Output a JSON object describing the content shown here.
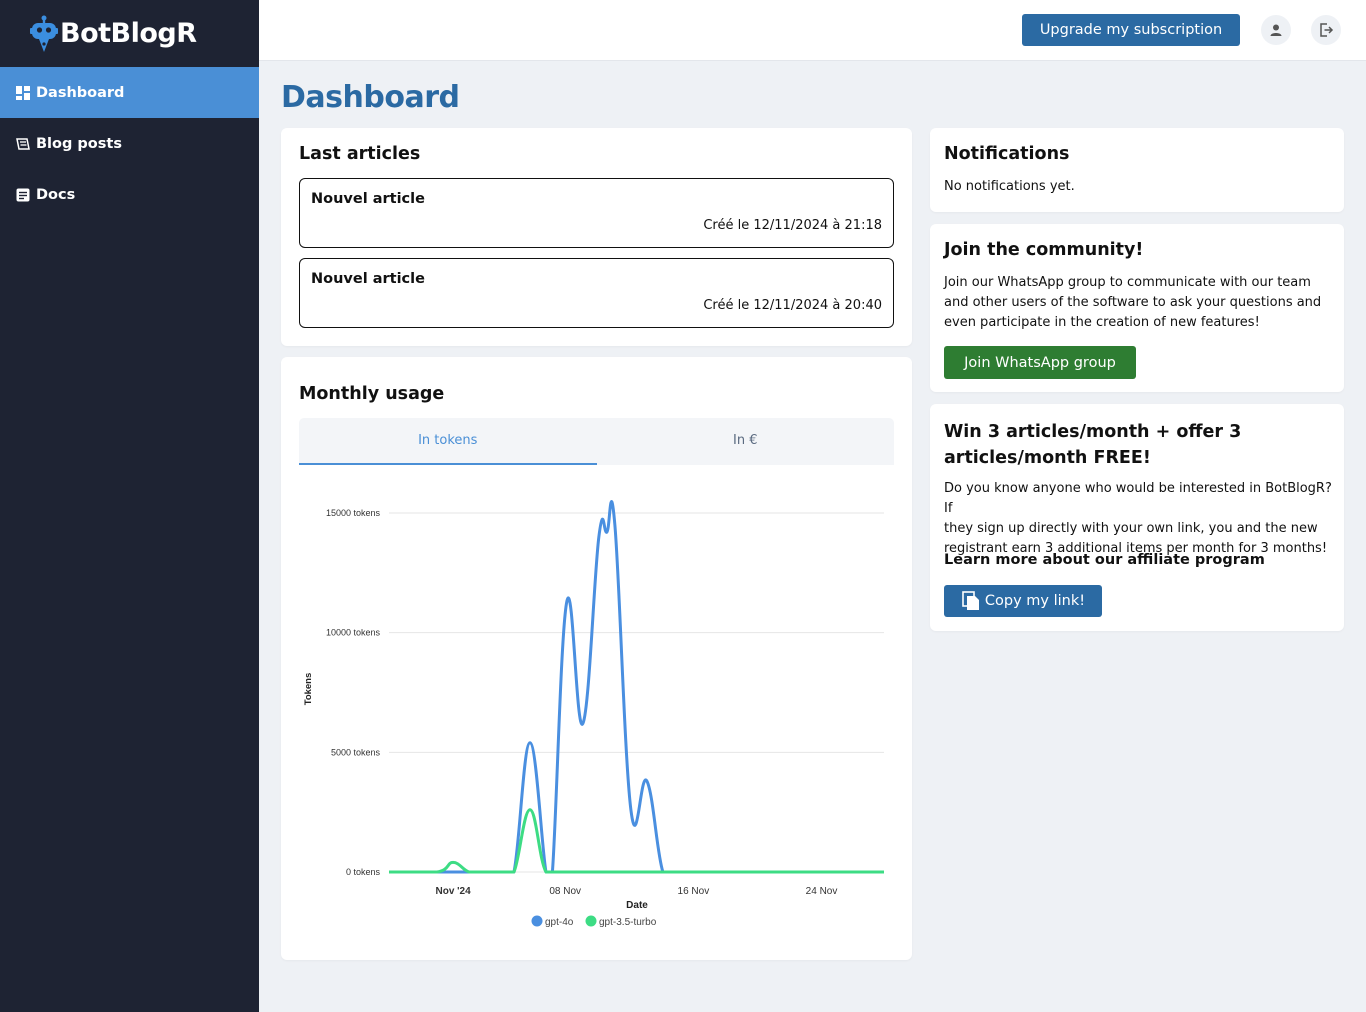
{
  "app": {
    "name": "BotBlogR"
  },
  "sidebar": {
    "items": [
      {
        "label": "Dashboard",
        "icon": "dashboard-icon",
        "active": true
      },
      {
        "label": "Blog posts",
        "icon": "blog-posts-icon",
        "active": false
      },
      {
        "label": "Docs",
        "icon": "docs-icon",
        "active": false
      }
    ]
  },
  "topbar": {
    "upgrade_label": "Upgrade my subscription",
    "account_icon": "user-icon",
    "logout_icon": "logout-icon"
  },
  "page": {
    "title": "Dashboard"
  },
  "last_articles": {
    "title": "Last articles",
    "items": [
      {
        "title": "Nouvel article",
        "date": "Créé le 12/11/2024 à 21:18"
      },
      {
        "title": "Nouvel article",
        "date": "Créé le 12/11/2024 à 20:40"
      }
    ]
  },
  "monthly_usage": {
    "title": "Monthly usage",
    "tabs": [
      {
        "label": "In tokens",
        "active": true
      },
      {
        "label": "In €",
        "active": false
      }
    ]
  },
  "chart_data": {
    "type": "line",
    "xlabel": "Date",
    "ylabel": "Tokens",
    "ylim": [
      0,
      15000
    ],
    "y_ticks": [
      {
        "value": 0,
        "label": "0 tokens"
      },
      {
        "value": 5000,
        "label": "5000 tokens"
      },
      {
        "value": 10000,
        "label": "10000 tokens"
      },
      {
        "value": 15000,
        "label": "15000 tokens"
      }
    ],
    "x_ticks": [
      {
        "day": 1,
        "label": "Nov '24",
        "bold": true
      },
      {
        "day": 8,
        "label": "08 Nov",
        "bold": false
      },
      {
        "day": 16,
        "label": "16 Nov",
        "bold": false
      },
      {
        "day": 24,
        "label": "24 Nov",
        "bold": false
      }
    ],
    "xlim": [
      -3,
      27.9
    ],
    "grid": true,
    "legend_position": "bottom",
    "series": [
      {
        "name": "gpt-4o",
        "color": "#4a8fe0",
        "points": [
          [
            -3,
            0
          ],
          [
            0,
            0
          ],
          [
            1,
            0
          ],
          [
            2,
            0
          ],
          [
            3,
            0
          ],
          [
            4,
            0
          ],
          [
            4.8,
            0
          ],
          [
            5.8,
            5400
          ],
          [
            6.8,
            0
          ],
          [
            7.2,
            0
          ],
          [
            8.1,
            11300
          ],
          [
            9.1,
            6200
          ],
          [
            10.1,
            14000
          ],
          [
            10.6,
            14200
          ],
          [
            11.1,
            14500
          ],
          [
            12.1,
            2600
          ],
          [
            13.1,
            3800
          ],
          [
            14.1,
            0
          ],
          [
            15,
            0
          ],
          [
            16,
            0
          ],
          [
            18,
            0
          ],
          [
            20,
            0
          ],
          [
            22,
            0
          ],
          [
            24,
            0
          ],
          [
            26,
            0
          ],
          [
            27.9,
            0
          ]
        ]
      },
      {
        "name": "gpt-3.5-turbo",
        "color": "#3ddc84",
        "points": [
          [
            -3,
            0
          ],
          [
            0,
            0
          ],
          [
            1,
            400
          ],
          [
            2,
            0
          ],
          [
            3,
            0
          ],
          [
            4,
            0
          ],
          [
            4.8,
            0
          ],
          [
            5.8,
            2600
          ],
          [
            6.8,
            0
          ],
          [
            8,
            0
          ],
          [
            10,
            0
          ],
          [
            12,
            0
          ],
          [
            14,
            0
          ],
          [
            16,
            0
          ],
          [
            18,
            0
          ],
          [
            20,
            0
          ],
          [
            22,
            0
          ],
          [
            24,
            0
          ],
          [
            26,
            0
          ],
          [
            27.9,
            0
          ]
        ]
      }
    ]
  },
  "notifications": {
    "title": "Notifications",
    "empty_text": "No notifications yet."
  },
  "community": {
    "title": "Join the community!",
    "line1": "Join our WhatsApp group to communicate with our team",
    "line2": "and other users of the software to ask your questions and",
    "line3": "even participate in the creation of new features!",
    "button_label": "Join WhatsApp group"
  },
  "affiliate": {
    "title_line1": "Win 3 articles/month + offer 3",
    "title_line2": "articles/month FREE!",
    "line1": "Do you know anyone who would be interested in BotBlogR? If",
    "line2": "they sign up directly with your own link, you and the new",
    "line3": "registrant earn 3 additional items per month for 3 months!",
    "learn_more": "Learn more about our affiliate program",
    "copy_label": "Copy my link!",
    "copy_icon": "copy-icon"
  },
  "colors": {
    "sidebar_bg": "#1e2333",
    "accent": "#2b6aa3",
    "active_nav": "#4a8fd6",
    "whatsapp_green": "#2e7d32"
  }
}
